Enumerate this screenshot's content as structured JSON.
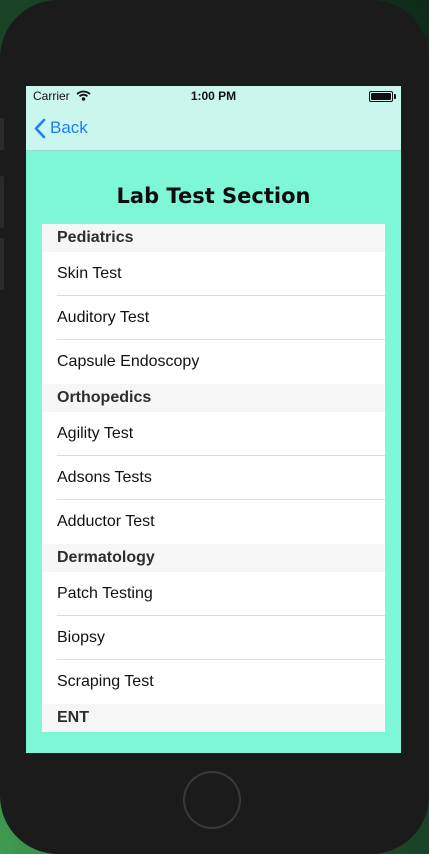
{
  "status": {
    "carrier": "Carrier",
    "time": "1:00 PM"
  },
  "nav": {
    "back_label": "Back"
  },
  "page": {
    "title": "Lab Test Section"
  },
  "sections": [
    {
      "header": "Pediatrics",
      "items": [
        "Skin Test",
        "Auditory Test",
        "Capsule Endoscopy"
      ]
    },
    {
      "header": "Orthopedics",
      "items": [
        "Agility Test",
        "Adsons Tests",
        "Adductor Test"
      ]
    },
    {
      "header": "Dermatology",
      "items": [
        "Patch Testing",
        "Biopsy",
        "Scraping Test"
      ]
    },
    {
      "header": "ENT",
      "items": []
    }
  ],
  "colors": {
    "screen_bg": "#7ef7d6",
    "nav_bg": "#cbf6ee",
    "accent": "#1e7ef5"
  },
  "icons": {
    "wifi": "wifi-icon",
    "battery": "battery-icon",
    "back": "chevron-left-icon"
  }
}
